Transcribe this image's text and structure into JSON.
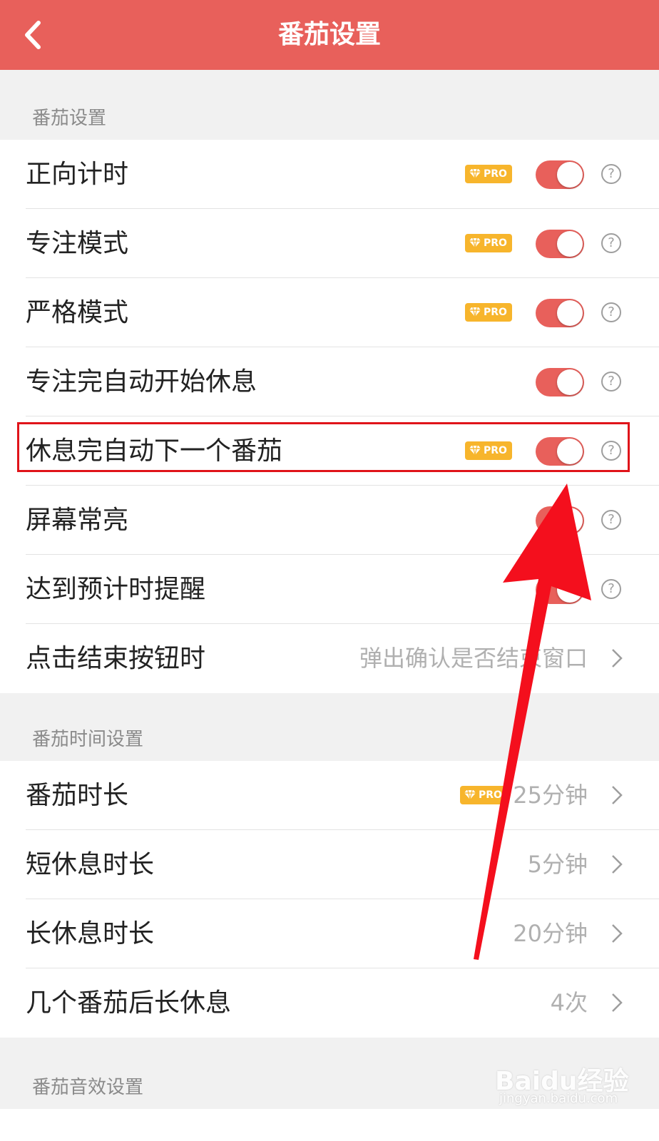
{
  "nav": {
    "title": "番茄设置"
  },
  "section1": {
    "header": "番茄设置",
    "rows": [
      {
        "label": "正向计时",
        "pro": "PRO",
        "toggle_on": true
      },
      {
        "label": "专注模式",
        "pro": "PRO",
        "toggle_on": true
      },
      {
        "label": "严格模式",
        "pro": "PRO",
        "toggle_on": true
      },
      {
        "label": "专注完自动开始休息",
        "toggle_on": true
      },
      {
        "label": "休息完自动下一个番茄",
        "pro": "PRO",
        "toggle_on": true
      },
      {
        "label": "屏幕常亮",
        "toggle_on": true
      },
      {
        "label": "达到预计时提醒",
        "toggle_on": true
      },
      {
        "label": "点击结束按钮时",
        "value": "弹出确认是否结束窗口"
      }
    ]
  },
  "section2": {
    "header": "番茄时间设置",
    "rows": [
      {
        "label": "番茄时长",
        "pro": "PRO",
        "value": "25分钟"
      },
      {
        "label": "短休息时长",
        "value": "5分钟"
      },
      {
        "label": "长休息时长",
        "value": "20分钟"
      },
      {
        "label": "几个番茄后长休息",
        "value": "4次"
      }
    ]
  },
  "section3": {
    "header": "番茄音效设置"
  },
  "help_glyph": "?",
  "watermark": {
    "logo": "Baidu经验",
    "url": "jingyan.baidu.com"
  },
  "colors": {
    "accent": "#e8605b",
    "pro_badge": "#f7b52c",
    "annotation": "#e0141a"
  }
}
